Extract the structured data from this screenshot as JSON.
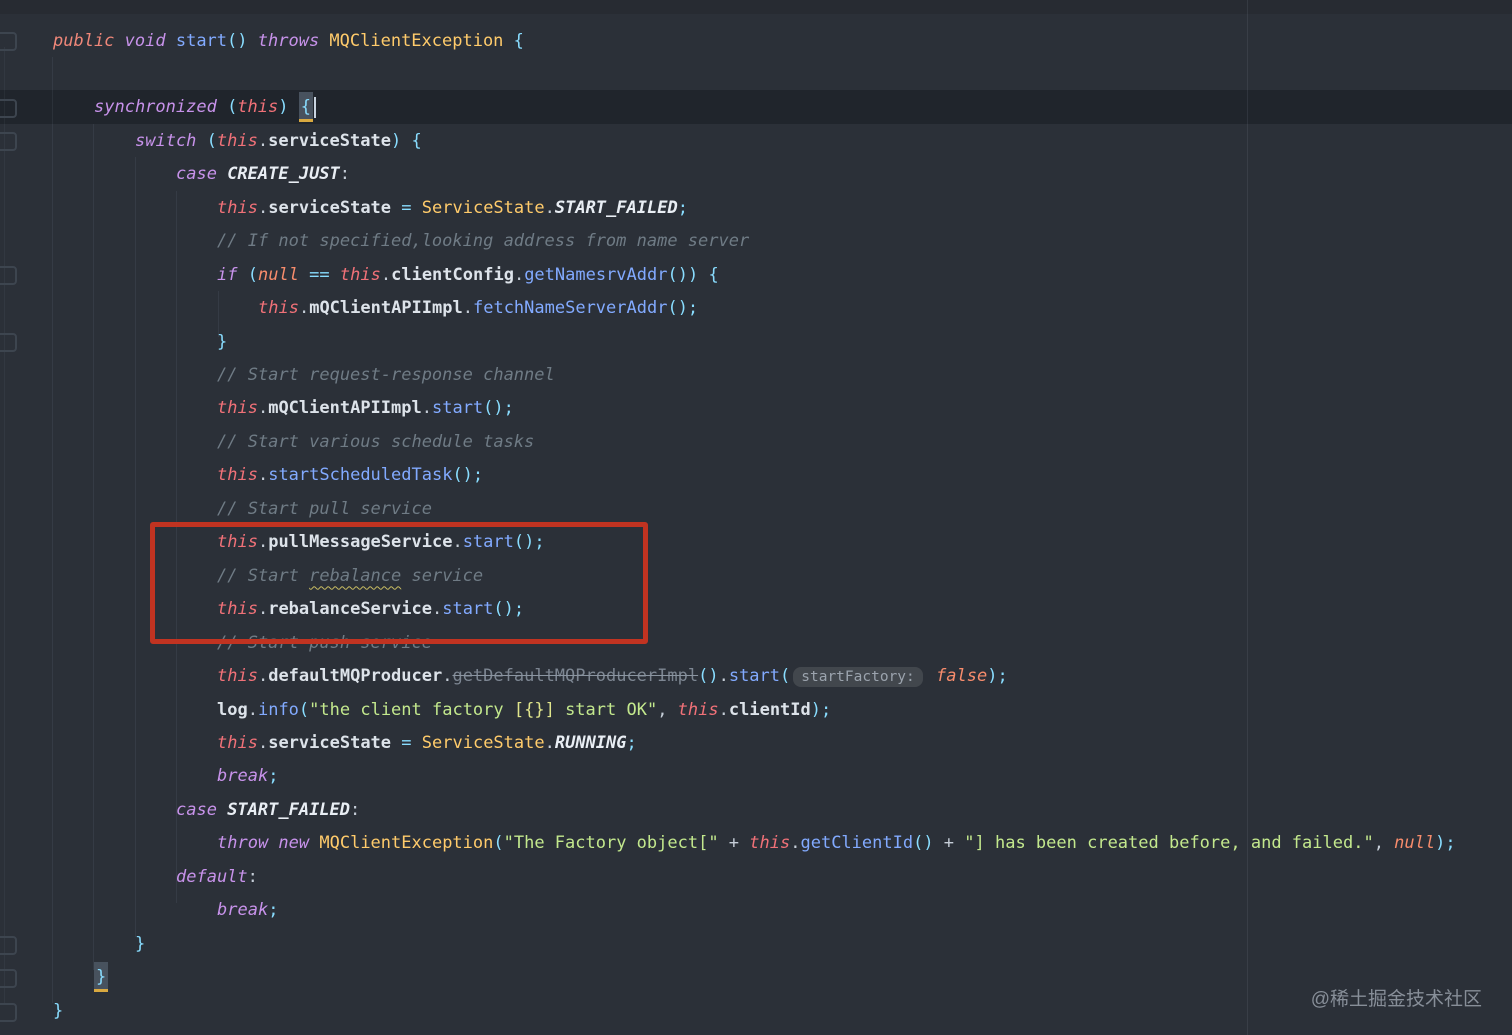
{
  "editor": {
    "background": "#2b3038",
    "caret_line_color": "#20252c",
    "annotation_box_color": "#c13321",
    "watermark": "@稀土掘金技术社区",
    "token_colors": {
      "keyword": "#c792ea",
      "modifier_public": "#ef8779",
      "this": "#f07178",
      "literal": "#f78c6c",
      "class": "#ffcb6b",
      "method": "#82aaff",
      "field": "#dde3ea",
      "enum_constant": "#e9eef4",
      "string": "#c3e88d",
      "comment": "#6f7b85",
      "punctuation": "#89ddff",
      "deprecated": "#7d8692",
      "brace_match_bg": "#48525e",
      "brace_match_underline": "#d9a940",
      "typo_squiggle": "#c9bd62",
      "parameter_hint_bg": "#42474d",
      "parameter_hint_text": "#9ba3ad"
    },
    "parameter_hint": "startFactory:",
    "typo_word": "rebalance",
    "lines": [
      {
        "indent": 0,
        "tokens": [
          [
            "pub",
            "public "
          ],
          [
            "k",
            "void "
          ],
          [
            "fn",
            "start"
          ],
          [
            "p",
            "()"
          ],
          [
            "d",
            " "
          ],
          [
            "k",
            "throws "
          ],
          [
            "cls",
            "MQClientException "
          ],
          [
            "p",
            "{"
          ]
        ]
      },
      {
        "indent": 0,
        "tokens": []
      },
      {
        "indent": 1,
        "tokens": [
          [
            "k",
            "synchronized "
          ],
          [
            "p",
            "("
          ],
          [
            "th",
            "this"
          ],
          [
            "p",
            ")"
          ],
          [
            "d",
            " "
          ],
          [
            "braceHL",
            "{"
          ],
          [
            "caret",
            ""
          ]
        ]
      },
      {
        "indent": 2,
        "tokens": [
          [
            "k",
            "switch "
          ],
          [
            "p",
            "("
          ],
          [
            "th",
            "this"
          ],
          [
            "d",
            "."
          ],
          [
            "fld",
            "serviceState"
          ],
          [
            "p",
            ")"
          ],
          [
            "d",
            " "
          ],
          [
            "p",
            "{"
          ]
        ]
      },
      {
        "indent": 3,
        "tokens": [
          [
            "k",
            "case "
          ],
          [
            "en",
            "CREATE_JUST"
          ],
          [
            "d",
            ":"
          ]
        ]
      },
      {
        "indent": 4,
        "tokens": [
          [
            "th",
            "this"
          ],
          [
            "d",
            "."
          ],
          [
            "fld",
            "serviceState"
          ],
          [
            "d",
            " "
          ],
          [
            "p",
            "="
          ],
          [
            "d",
            " "
          ],
          [
            "cls",
            "ServiceState"
          ],
          [
            "d",
            "."
          ],
          [
            "en",
            "START_FAILED"
          ],
          [
            "p",
            ";"
          ]
        ]
      },
      {
        "indent": 4,
        "tokens": [
          [
            "cm",
            "// If not specified,looking address from name server"
          ]
        ]
      },
      {
        "indent": 4,
        "tokens": [
          [
            "k",
            "if "
          ],
          [
            "p",
            "("
          ],
          [
            "lit",
            "null"
          ],
          [
            "d",
            " "
          ],
          [
            "p",
            "=="
          ],
          [
            "d",
            " "
          ],
          [
            "th",
            "this"
          ],
          [
            "d",
            "."
          ],
          [
            "fld",
            "clientConfig"
          ],
          [
            "d",
            "."
          ],
          [
            "fn",
            "getNamesrvAddr"
          ],
          [
            "p",
            "())"
          ],
          [
            "d",
            " "
          ],
          [
            "p",
            "{"
          ]
        ]
      },
      {
        "indent": 5,
        "tokens": [
          [
            "th",
            "this"
          ],
          [
            "d",
            "."
          ],
          [
            "fld",
            "mQClientAPIImpl"
          ],
          [
            "d",
            "."
          ],
          [
            "fn",
            "fetchNameServerAddr"
          ],
          [
            "p",
            "();"
          ]
        ]
      },
      {
        "indent": 4,
        "tokens": [
          [
            "p",
            "}"
          ]
        ]
      },
      {
        "indent": 4,
        "tokens": [
          [
            "cm",
            "// Start request-response channel"
          ]
        ]
      },
      {
        "indent": 4,
        "tokens": [
          [
            "th",
            "this"
          ],
          [
            "d",
            "."
          ],
          [
            "fld",
            "mQClientAPIImpl"
          ],
          [
            "d",
            "."
          ],
          [
            "fn",
            "start"
          ],
          [
            "p",
            "();"
          ]
        ]
      },
      {
        "indent": 4,
        "tokens": [
          [
            "cm",
            "// Start various schedule tasks"
          ]
        ]
      },
      {
        "indent": 4,
        "tokens": [
          [
            "th",
            "this"
          ],
          [
            "d",
            "."
          ],
          [
            "fn",
            "startScheduledTask"
          ],
          [
            "p",
            "();"
          ]
        ]
      },
      {
        "indent": 4,
        "tokens": [
          [
            "cm",
            "// Start pull service"
          ]
        ]
      },
      {
        "indent": 4,
        "tokens": [
          [
            "th",
            "this"
          ],
          [
            "d",
            "."
          ],
          [
            "fld",
            "pullMessageService"
          ],
          [
            "d",
            "."
          ],
          [
            "fn",
            "start"
          ],
          [
            "p",
            "();"
          ]
        ]
      },
      {
        "indent": 4,
        "tokens": [
          [
            "cm",
            "// Start "
          ],
          [
            "wavy",
            "rebalance"
          ],
          [
            "cm",
            " service"
          ]
        ]
      },
      {
        "indent": 4,
        "tokens": [
          [
            "th",
            "this"
          ],
          [
            "d",
            "."
          ],
          [
            "fld",
            "rebalanceService"
          ],
          [
            "d",
            "."
          ],
          [
            "fn",
            "start"
          ],
          [
            "p",
            "();"
          ]
        ]
      },
      {
        "indent": 4,
        "tokens": [
          [
            "cm",
            "// Start push service"
          ]
        ]
      },
      {
        "indent": 4,
        "tokens": [
          [
            "th",
            "this"
          ],
          [
            "d",
            "."
          ],
          [
            "fld",
            "defaultMQProducer"
          ],
          [
            "d",
            "."
          ],
          [
            "dep",
            "getDefaultMQProducerImpl"
          ],
          [
            "p",
            "()"
          ],
          [
            "d",
            "."
          ],
          [
            "fn",
            "start"
          ],
          [
            "p",
            "("
          ],
          [
            "hint",
            "startFactory:"
          ],
          [
            "d",
            " "
          ],
          [
            "lit",
            "false"
          ],
          [
            "p",
            ");"
          ]
        ]
      },
      {
        "indent": 4,
        "tokens": [
          [
            "fld",
            "log"
          ],
          [
            "d",
            "."
          ],
          [
            "fn",
            "info"
          ],
          [
            "p",
            "("
          ],
          [
            "str",
            "\"the client factory "
          ],
          [
            "strq",
            "[{}]"
          ],
          [
            "str",
            " start OK\""
          ],
          [
            "d",
            ", "
          ],
          [
            "th",
            "this"
          ],
          [
            "d",
            "."
          ],
          [
            "fld",
            "clientId"
          ],
          [
            "p",
            ");"
          ]
        ]
      },
      {
        "indent": 4,
        "tokens": [
          [
            "th",
            "this"
          ],
          [
            "d",
            "."
          ],
          [
            "fld",
            "serviceState"
          ],
          [
            "d",
            " "
          ],
          [
            "p",
            "="
          ],
          [
            "d",
            " "
          ],
          [
            "cls",
            "ServiceState"
          ],
          [
            "d",
            "."
          ],
          [
            "en",
            "RUNNING"
          ],
          [
            "p",
            ";"
          ]
        ]
      },
      {
        "indent": 4,
        "tokens": [
          [
            "k",
            "break"
          ],
          [
            "p",
            ";"
          ]
        ]
      },
      {
        "indent": 3,
        "tokens": [
          [
            "k",
            "case "
          ],
          [
            "en",
            "START_FAILED"
          ],
          [
            "d",
            ":"
          ]
        ]
      },
      {
        "indent": 4,
        "tokens": [
          [
            "k",
            "throw "
          ],
          [
            "k",
            "new "
          ],
          [
            "cls",
            "MQClientException"
          ],
          [
            "p",
            "("
          ],
          [
            "str",
            "\"The Factory object[\""
          ],
          [
            "d",
            " + "
          ],
          [
            "th",
            "this"
          ],
          [
            "d",
            "."
          ],
          [
            "fn",
            "getClientId"
          ],
          [
            "p",
            "()"
          ],
          [
            "d",
            " + "
          ],
          [
            "str",
            "\"] has been created before, and failed.\""
          ],
          [
            "d",
            ", "
          ],
          [
            "lit",
            "null"
          ],
          [
            "p",
            ");"
          ]
        ]
      },
      {
        "indent": 3,
        "tokens": [
          [
            "k",
            "default"
          ],
          [
            "d",
            ":"
          ]
        ]
      },
      {
        "indent": 4,
        "tokens": [
          [
            "k",
            "break"
          ],
          [
            "p",
            ";"
          ]
        ]
      },
      {
        "indent": 2,
        "tokens": [
          [
            "p",
            "}"
          ]
        ]
      },
      {
        "indent": 1,
        "tokens": [
          [
            "braceHL2",
            "}"
          ]
        ]
      },
      {
        "indent": 0,
        "tokens": [
          [
            "p",
            "}"
          ]
        ]
      }
    ]
  }
}
